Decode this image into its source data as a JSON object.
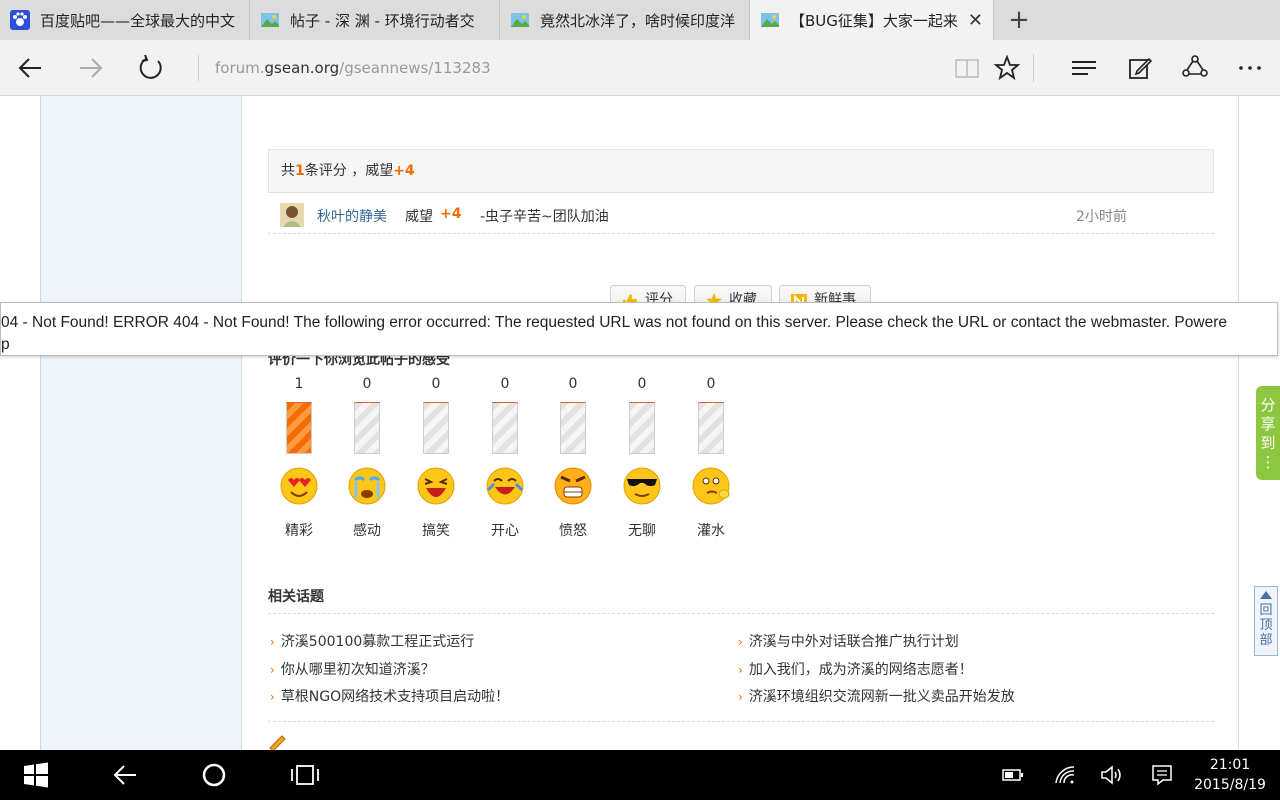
{
  "tabs": [
    {
      "title": "百度贴吧——全球最大的中文",
      "active": false
    },
    {
      "title": "帖子 - 深 渊 - 环境行动者交",
      "active": false
    },
    {
      "title": "竟然北冰洋了，啥时候印度洋",
      "active": false
    },
    {
      "title": "【BUG征集】大家一起来",
      "active": true
    }
  ],
  "address": {
    "prefix": "forum.",
    "domain": "gsean.org",
    "path": "/gseannews/113283"
  },
  "rating_summary": {
    "pre": "共",
    "count": "1",
    "mid": "条评分 ，威望",
    "total": "+4"
  },
  "rating_entry": {
    "user": "秋叶的静美",
    "label": "威望",
    "value": "+4",
    "comment": "-虫子辛苦~团队加油",
    "time": "2小时前"
  },
  "actions": [
    {
      "label": "评分",
      "icon": "thumb-up-icon"
    },
    {
      "label": "收藏",
      "icon": "star-icon"
    },
    {
      "label": "新鲜事",
      "icon": "news-icon"
    }
  ],
  "error_popup": {
    "line1": "04 - Not Found! ERROR 404 - Not Found! The following error occurred: The requested URL was not found on this server. Please check the URL or contact the webmaster. Powere",
    "line2": "p"
  },
  "feel_header": "评价一下你浏览此帖子的感受",
  "moods": [
    {
      "count": "1",
      "label": "精彩",
      "level": 1.0,
      "face": "heart-eyes-face"
    },
    {
      "count": "0",
      "label": "感动",
      "level": 0,
      "face": "crying-face"
    },
    {
      "count": "0",
      "label": "搞笑",
      "level": 0,
      "face": "laughing-face"
    },
    {
      "count": "0",
      "label": "开心",
      "level": 0,
      "face": "happy-face"
    },
    {
      "count": "0",
      "label": "愤怒",
      "level": 0,
      "face": "angry-face"
    },
    {
      "count": "0",
      "label": "无聊",
      "level": 0,
      "face": "sunglasses-face"
    },
    {
      "count": "0",
      "label": "灌水",
      "level": 0,
      "face": "thinking-face"
    }
  ],
  "related": {
    "title": "相关话题",
    "left": [
      "济溪500100募款工程正式运行",
      "你从哪里初次知道济溪？",
      "草根NGO网络技术支持项目启动啦！"
    ],
    "right": [
      "济溪与中外对话联合推广执行计划",
      "加入我们，成为济溪的网络志愿者！",
      "济溪环境组织交流网新一批义卖品开始发放"
    ]
  },
  "side": {
    "share": [
      "分",
      "享",
      "到",
      "⋮"
    ],
    "totop": [
      "回",
      "顶",
      "部"
    ]
  },
  "clock": {
    "time": "21:01",
    "date": "2015/8/19"
  },
  "colors": {
    "accent": "#f26c00",
    "link": "#336699",
    "share_green": "#8dc63f"
  }
}
